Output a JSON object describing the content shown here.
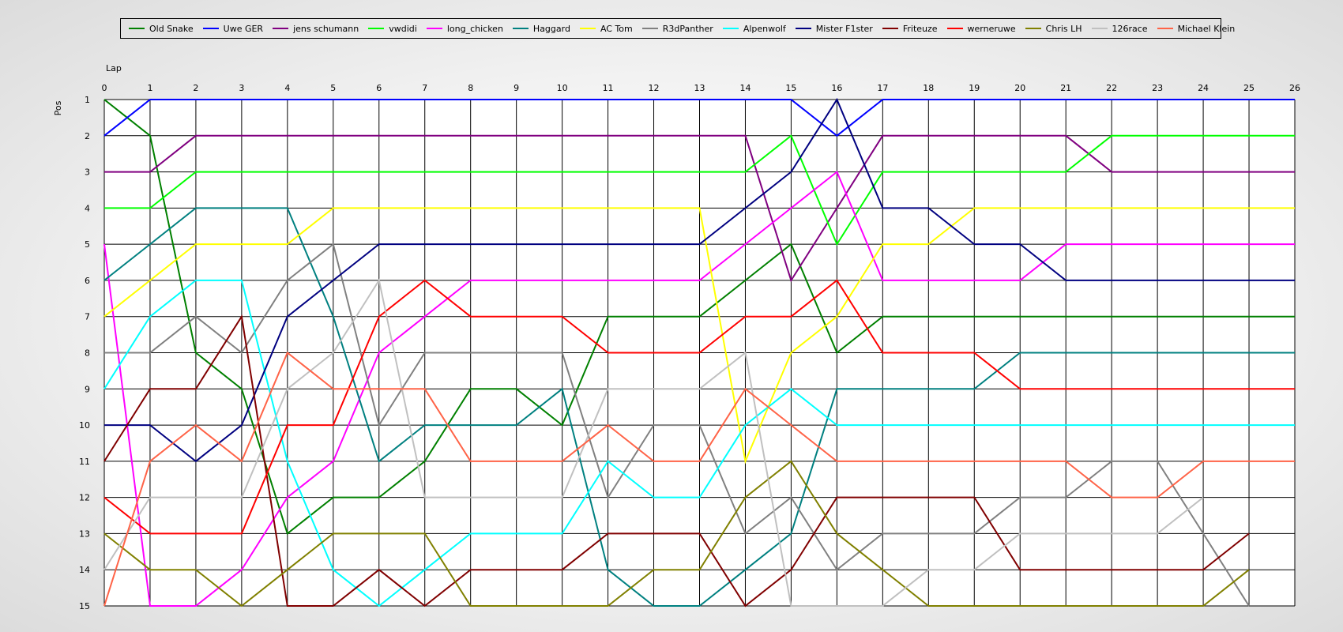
{
  "chart_data": {
    "type": "line",
    "xlabel": "Lap",
    "ylabel": "Pos",
    "xlim": [
      0,
      26
    ],
    "ylim": [
      1,
      15
    ],
    "y_inverted": true,
    "grid": true,
    "legend_position": "top",
    "x": [
      0,
      1,
      2,
      3,
      4,
      5,
      6,
      7,
      8,
      9,
      10,
      11,
      12,
      13,
      14,
      15,
      16,
      17,
      18,
      19,
      20,
      21,
      22,
      23,
      24,
      25,
      26
    ],
    "series": [
      {
        "name": "Old Snake",
        "color": "#008000",
        "values": [
          1,
          2,
          8,
          9,
          13,
          12,
          12,
          11,
          9,
          9,
          10,
          7,
          7,
          7,
          6,
          5,
          8,
          7,
          7,
          7,
          7,
          7,
          7,
          7,
          7,
          7,
          7
        ]
      },
      {
        "name": "Uwe GER",
        "color": "#0000ff",
        "values": [
          2,
          1,
          1,
          1,
          1,
          1,
          1,
          1,
          1,
          1,
          1,
          1,
          1,
          1,
          1,
          1,
          2,
          1,
          1,
          1,
          1,
          1,
          1,
          1,
          1,
          1,
          1
        ]
      },
      {
        "name": "jens  schumann",
        "color": "#800080",
        "values": [
          3,
          3,
          2,
          2,
          2,
          2,
          2,
          2,
          2,
          2,
          2,
          2,
          2,
          2,
          2,
          6,
          4,
          2,
          2,
          2,
          2,
          2,
          3,
          3,
          3,
          3,
          3
        ]
      },
      {
        "name": "vwdidi",
        "color": "#00ff00",
        "values": [
          4,
          4,
          3,
          3,
          3,
          3,
          3,
          3,
          3,
          3,
          3,
          3,
          3,
          3,
          3,
          2,
          5,
          3,
          3,
          3,
          3,
          3,
          2,
          2,
          2,
          2,
          2
        ]
      },
      {
        "name": "long_chicken",
        "color": "#ff00ff",
        "values": [
          5,
          15,
          15,
          14,
          12,
          11,
          8,
          7,
          6,
          6,
          6,
          6,
          6,
          6,
          5,
          4,
          3,
          6,
          6,
          6,
          6,
          5,
          5,
          5,
          5,
          5,
          5
        ]
      },
      {
        "name": "Haggard",
        "color": "#008080",
        "values": [
          6,
          5,
          4,
          4,
          4,
          7,
          11,
          10,
          10,
          10,
          9,
          14,
          15,
          15,
          14,
          13,
          9,
          9,
          9,
          9,
          8,
          8,
          8,
          8,
          8,
          8,
          8
        ]
      },
      {
        "name": "AC Tom",
        "color": "#ffff00",
        "values": [
          7,
          6,
          5,
          5,
          5,
          4,
          4,
          4,
          4,
          4,
          4,
          4,
          4,
          4,
          11,
          8,
          7,
          5,
          5,
          4,
          4,
          4,
          4,
          4,
          4,
          4,
          4
        ]
      },
      {
        "name": "R3dPanther",
        "color": "#808080",
        "values": [
          8,
          8,
          7,
          8,
          6,
          5,
          10,
          8,
          8,
          8,
          8,
          12,
          10,
          10,
          13,
          12,
          14,
          13,
          13,
          13,
          12,
          12,
          11,
          11,
          13,
          15,
          null
        ]
      },
      {
        "name": "Alpenwolf",
        "color": "#00ffff",
        "values": [
          9,
          7,
          6,
          6,
          11,
          14,
          15,
          14,
          13,
          13,
          13,
          11,
          12,
          12,
          10,
          9,
          10,
          10,
          10,
          10,
          10,
          10,
          10,
          10,
          10,
          10,
          10
        ]
      },
      {
        "name": "Mister F1ster",
        "color": "#000080",
        "values": [
          10,
          10,
          11,
          10,
          7,
          6,
          5,
          5,
          5,
          5,
          5,
          5,
          5,
          5,
          4,
          3,
          1,
          4,
          4,
          5,
          5,
          6,
          6,
          6,
          6,
          6,
          6
        ]
      },
      {
        "name": "Friteuze",
        "color": "#800000",
        "values": [
          11,
          9,
          9,
          7,
          15,
          15,
          14,
          15,
          14,
          14,
          14,
          13,
          13,
          13,
          15,
          14,
          12,
          12,
          12,
          12,
          14,
          14,
          14,
          14,
          14,
          13,
          null
        ]
      },
      {
        "name": "werneruwe",
        "color": "#ff0000",
        "values": [
          12,
          13,
          13,
          13,
          10,
          10,
          7,
          6,
          7,
          7,
          7,
          8,
          8,
          8,
          7,
          7,
          6,
          8,
          8,
          8,
          9,
          9,
          9,
          9,
          9,
          9,
          9
        ]
      },
      {
        "name": "Chris LH",
        "color": "#808000",
        "values": [
          13,
          14,
          14,
          15,
          14,
          13,
          13,
          13,
          15,
          15,
          15,
          15,
          14,
          14,
          12,
          11,
          13,
          14,
          15,
          15,
          15,
          15,
          15,
          15,
          15,
          14,
          null
        ]
      },
      {
        "name": "126race",
        "color": "#c0c0c0",
        "values": [
          14,
          12,
          12,
          12,
          9,
          8,
          6,
          12,
          12,
          12,
          12,
          9,
          9,
          9,
          8,
          15,
          15,
          15,
          14,
          14,
          13,
          13,
          13,
          13,
          12,
          null,
          null
        ]
      },
      {
        "name": "Michael Klein",
        "color": "#ff6347",
        "values": [
          15,
          11,
          10,
          11,
          8,
          9,
          9,
          9,
          11,
          11,
          11,
          10,
          11,
          11,
          9,
          10,
          11,
          11,
          11,
          11,
          11,
          11,
          12,
          12,
          11,
          11,
          11
        ]
      }
    ]
  }
}
